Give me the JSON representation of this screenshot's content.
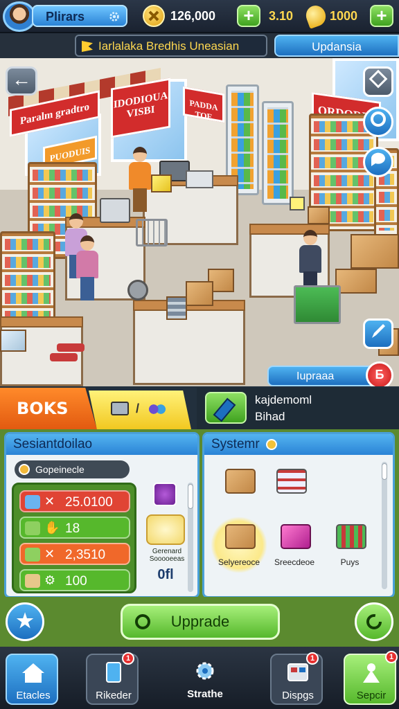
{
  "player": {
    "name": "Plirars"
  },
  "resources": {
    "cash": "126,000",
    "tickets": "3.10",
    "gems": "1000"
  },
  "news": {
    "text": "Iarlalaka Bredhis Uneasian"
  },
  "top_right_button": "Updansia",
  "scene": {
    "signs": [
      "Paralm gradtro",
      "IDODIOUA VISBI",
      "PADDA TOE",
      "PUODUIS",
      "ORDORIA"
    ],
    "upgrade_tag": "Iupraaa",
    "tag_badge_icon": "Б"
  },
  "categories": {
    "main": "BOKS",
    "yellow_text": "/",
    "dark_line1": "kajdemoml",
    "dark_line2": "Bihad"
  },
  "left_panel": {
    "title": "Sesiantdoilao",
    "pill": "Gopeinecle",
    "stats": [
      {
        "value": "25.0100",
        "color": "#e04434"
      },
      {
        "value": "18",
        "color": "#56b82c"
      },
      {
        "value": "2,3510",
        "color": "#f0682a"
      },
      {
        "value": "100",
        "color": "#56b82c"
      }
    ],
    "coupon_label": "Gerenard Sooooeeas",
    "coupon_off": "0fl"
  },
  "right_panel": {
    "title": "Systemr",
    "items": [
      {
        "caption": ""
      },
      {
        "caption": ""
      },
      {
        "caption": "Selyereoce"
      },
      {
        "caption": "Sreecdeoe"
      },
      {
        "caption": "Puys"
      }
    ]
  },
  "actions": {
    "upgrade_label": "Upprade"
  },
  "nav": [
    {
      "label": "Etacles",
      "badge": ""
    },
    {
      "label": "Rikeder",
      "badge": "1"
    },
    {
      "label": "Strathe",
      "badge": ""
    },
    {
      "label": "Dispgs",
      "badge": "1"
    },
    {
      "label": "Sepcir",
      "badge": "1"
    }
  ],
  "colors": {
    "accent_blue": "#2a83d6",
    "accent_green": "#56b82c",
    "accent_orange": "#e25a10",
    "accent_red": "#d22c2c"
  }
}
